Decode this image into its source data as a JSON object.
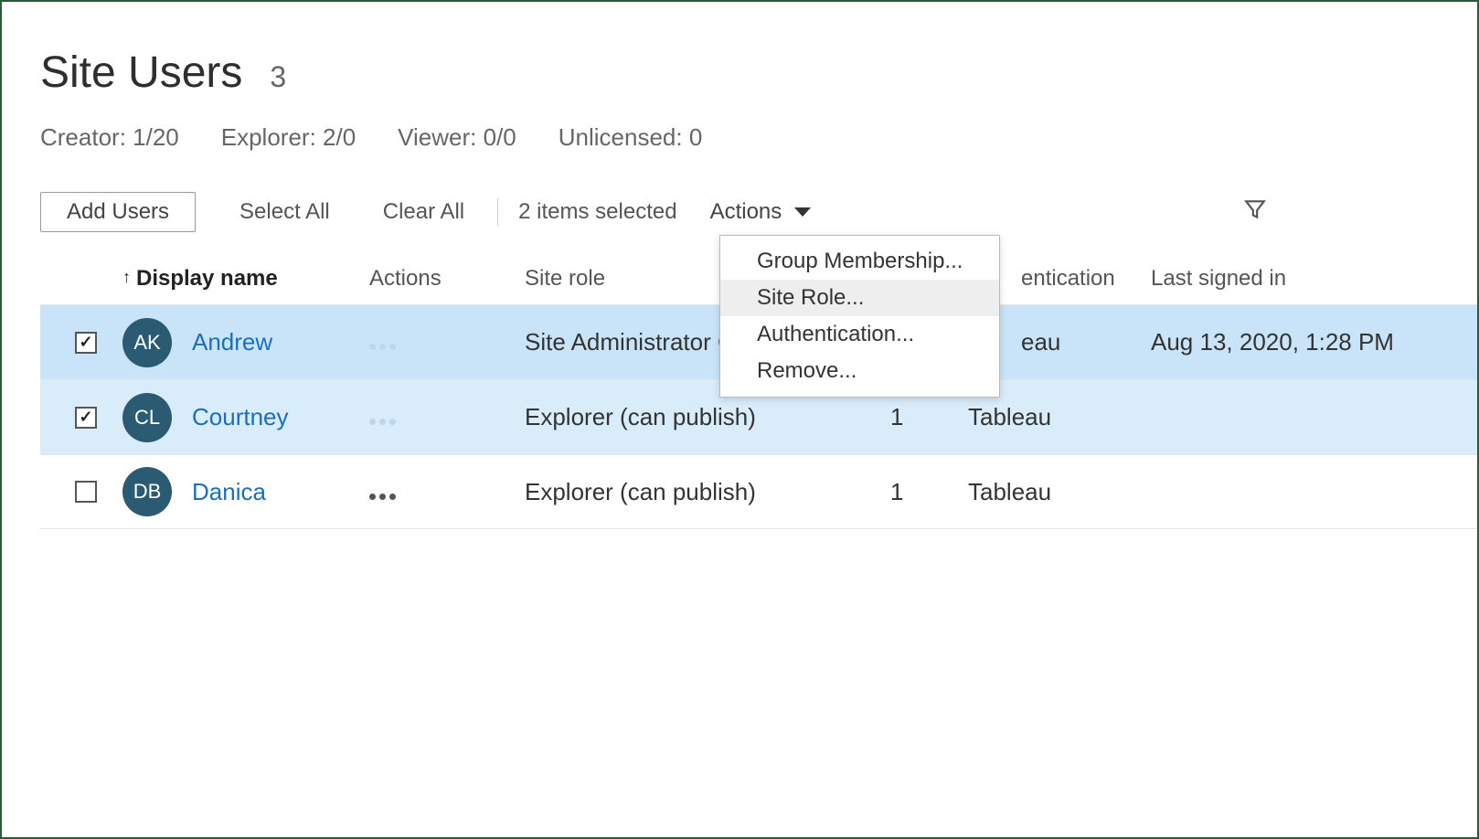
{
  "header": {
    "title": "Site Users",
    "count": "3"
  },
  "licenses": {
    "creator": "Creator: 1/20",
    "explorer": "Explorer: 2/0",
    "viewer": "Viewer: 0/0",
    "unlicensed": "Unlicensed: 0"
  },
  "toolbar": {
    "add_users": "Add Users",
    "select_all": "Select All",
    "clear_all": "Clear All",
    "selected_count": "2 items selected",
    "actions_label": "Actions"
  },
  "actions_menu": {
    "group_membership": "Group Membership...",
    "site_role": "Site Role...",
    "authentication": "Authentication...",
    "remove": "Remove..."
  },
  "columns": {
    "display_name": "Display name",
    "actions": "Actions",
    "site_role": "Site role",
    "authentication_partial": "entication",
    "last_signed_in": "Last signed in"
  },
  "rows": [
    {
      "selected": true,
      "initials": "AK",
      "name": "Andrew",
      "site_role": "Site Administrator Cre",
      "auth_partial": "eau",
      "last_signed_in": "Aug 13, 2020, 1:28 PM",
      "groups": ""
    },
    {
      "selected": true,
      "initials": "CL",
      "name": "Courtney",
      "site_role": "Explorer (can publish)",
      "groups": "1",
      "auth": "Tableau",
      "last_signed_in": ""
    },
    {
      "selected": false,
      "initials": "DB",
      "name": "Danica",
      "site_role": "Explorer (can publish)",
      "groups": "1",
      "auth": "Tableau",
      "last_signed_in": ""
    }
  ]
}
